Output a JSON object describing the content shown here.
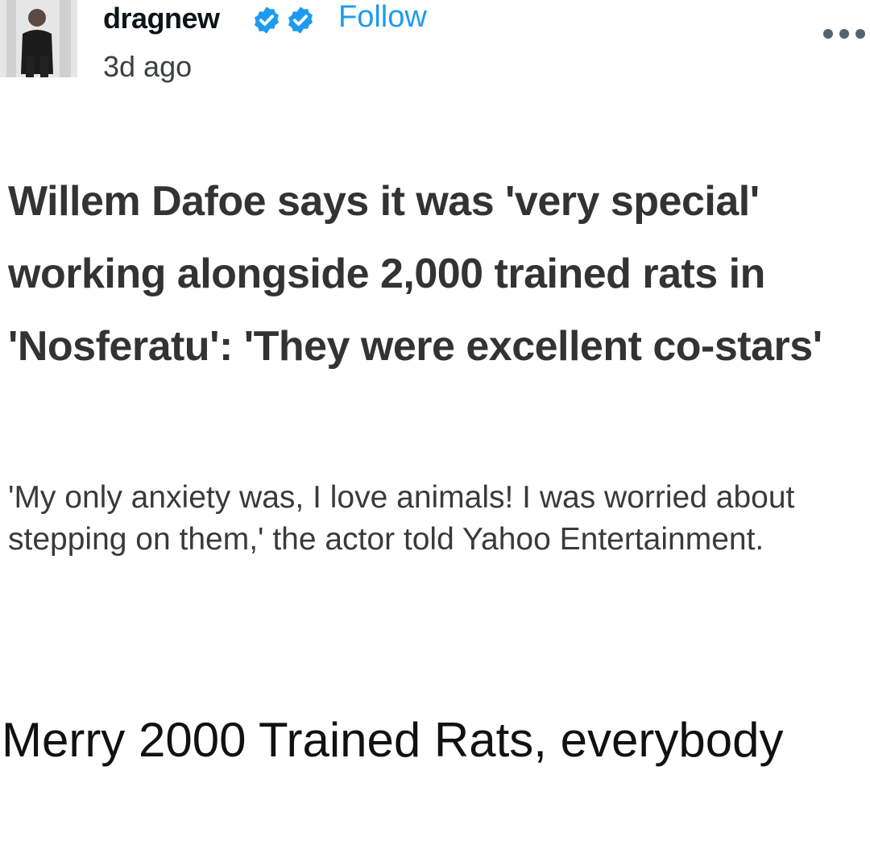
{
  "post": {
    "handle": "dragnew",
    "follow_label": "Follow",
    "time": "3d ago",
    "verified_badges": [
      "verified-badge-icon",
      "verified-badge-icon"
    ],
    "more_icon": "more-options-icon"
  },
  "article": {
    "headline": "Willem Dafoe says it was 'very special' working alongside 2,000 trained rats in 'Nosferatu': 'They were excellent co-stars'",
    "subhead": "'My only anxiety was, I love animals! I was worried about stepping on them,' the actor told Yahoo Entertainment."
  },
  "comment": {
    "text": "Merry 2000 Trained Rats, everybody"
  },
  "colors": {
    "accent": "#1d9bf0",
    "headline": "#333333",
    "body": "#3a3a3a"
  }
}
